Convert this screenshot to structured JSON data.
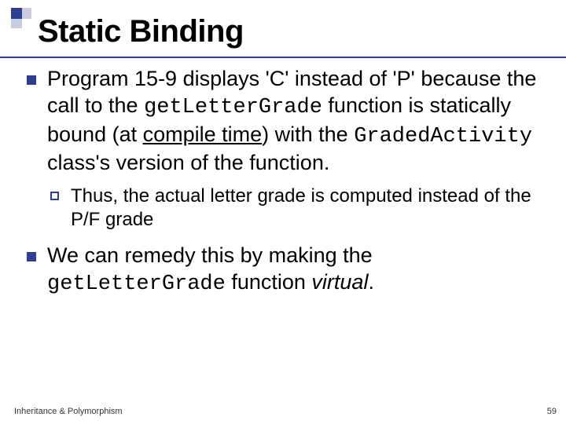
{
  "title": "Static Binding",
  "bullets": {
    "p1a": "Program 15-9 displays 'C' instead of 'P' because the call to the ",
    "p1code1": "getLetterGrade",
    "p1b": " function is statically bound (at ",
    "p1ul": "compile time",
    "p1c": ") with the ",
    "p1code2": "GradedActivity",
    "p1d": " class's version of the function.",
    "p2": "Thus, the actual letter grade is computed instead of the P/F grade",
    "p3a": "We can remedy this by making the ",
    "p3code": "getLetterGrade",
    "p3b": " function ",
    "p3it": "virtual",
    "p3c": "."
  },
  "footer": {
    "left": "Inheritance & Polymorphism",
    "right": "59"
  }
}
